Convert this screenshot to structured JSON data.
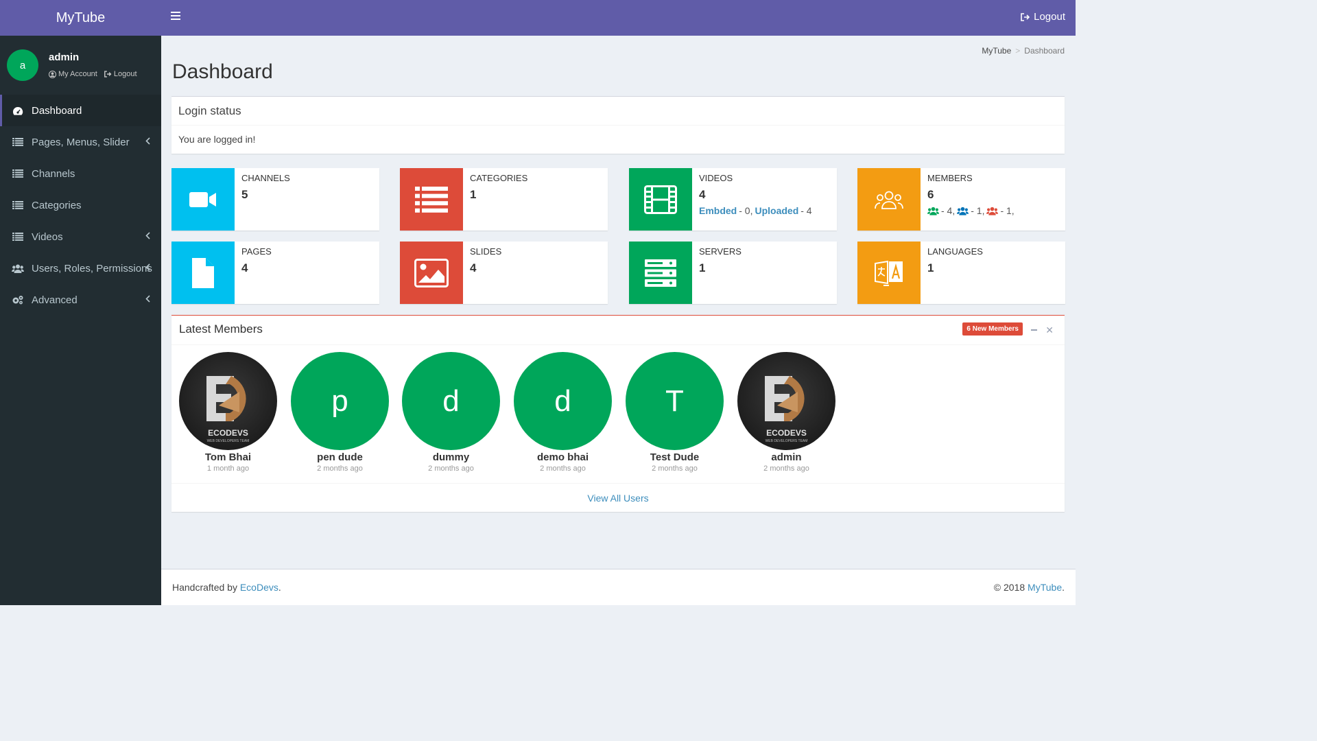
{
  "app": {
    "title": "MyTube",
    "logout_label": "Logout"
  },
  "sidebar": {
    "user": {
      "initial": "a",
      "name": "admin",
      "my_account": "My Account",
      "logout": "Logout"
    },
    "items": [
      {
        "label": "Dashboard",
        "icon": "dashboard-icon",
        "active": true
      },
      {
        "label": "Pages, Menus, Slider",
        "icon": "list-icon",
        "has_children": true
      },
      {
        "label": "Channels",
        "icon": "list-icon"
      },
      {
        "label": "Categories",
        "icon": "list-icon"
      },
      {
        "label": "Videos",
        "icon": "list-icon",
        "has_children": true
      },
      {
        "label": "Users, Roles, Permissions",
        "icon": "users-icon",
        "has_children": true
      },
      {
        "label": "Advanced",
        "icon": "cogs-icon",
        "has_children": true
      }
    ]
  },
  "breadcrumb": {
    "home": "MyTube",
    "current": "Dashboard"
  },
  "page": {
    "title": "Dashboard"
  },
  "login_box": {
    "title": "Login status",
    "message": "You are logged in!"
  },
  "stats": [
    {
      "label": "CHANNELS",
      "value": "5",
      "color": "#00c0ef",
      "icon": "video-camera-icon"
    },
    {
      "label": "CATEGORIES",
      "value": "1",
      "color": "#dd4b39",
      "icon": "list-icon"
    },
    {
      "label": "VIDEOS",
      "value": "4",
      "color": "#00a65a",
      "icon": "film-icon",
      "extra": {
        "embed_label": "Embded",
        "embed_count": "- 0,",
        "upload_label": "Uploaded",
        "upload_count": "- 4"
      }
    },
    {
      "label": "MEMBERS",
      "value": "6",
      "color": "#f39c12",
      "icon": "group-icon",
      "extra": {
        "green_count": "- 4,",
        "blue_count": "- 1,",
        "red_count": "- 1,"
      }
    },
    {
      "label": "PAGES",
      "value": "4",
      "color": "#00c0ef",
      "icon": "file-icon"
    },
    {
      "label": "SLIDES",
      "value": "4",
      "color": "#dd4b39",
      "icon": "image-icon"
    },
    {
      "label": "SERVERS",
      "value": "1",
      "color": "#00a65a",
      "icon": "server-icon"
    },
    {
      "label": "LANGUAGES",
      "value": "1",
      "color": "#f39c12",
      "icon": "language-icon"
    }
  ],
  "latest_members": {
    "title": "Latest Members",
    "badge": "6 New Members",
    "members": [
      {
        "name": "Tom Bhai",
        "ago": "1 month ago",
        "avatar": "image",
        "logo_text": "ECODEVS",
        "logo_sub": "WEB DEVELOPERS TEAM"
      },
      {
        "name": "pen dude",
        "ago": "2 months ago",
        "avatar": "p"
      },
      {
        "name": "dummy",
        "ago": "2 months ago",
        "avatar": "d"
      },
      {
        "name": "demo bhai",
        "ago": "2 months ago",
        "avatar": "d"
      },
      {
        "name": "Test Dude",
        "ago": "2 months ago",
        "avatar": "T"
      },
      {
        "name": "admin",
        "ago": "2 months ago",
        "avatar": "image",
        "logo_text": "ECODEVS",
        "logo_sub": "WEB DEVELOPERS TEAM"
      }
    ],
    "view_all": "View All Users"
  },
  "footer": {
    "left_prefix": "Handcrafted by",
    "left_link": "EcoDevs",
    "left_suffix": ".",
    "right_prefix": "© 2018",
    "right_link": "MyTube",
    "right_suffix": "."
  }
}
